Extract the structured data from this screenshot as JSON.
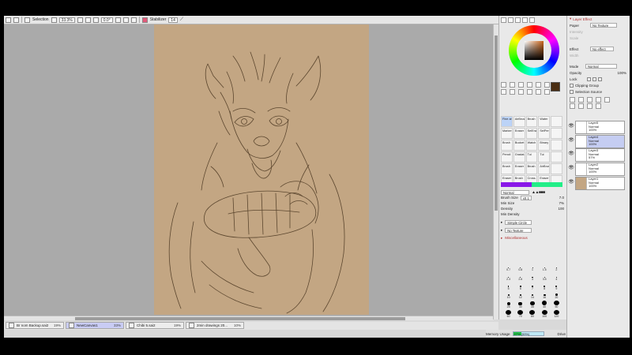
{
  "toolbar": {
    "selection_label": "Selection",
    "zoom": "33.3%",
    "angle": "0.0°",
    "stabilizer_label": "Stabilizer",
    "stabilizer_value": "14"
  },
  "tabs": [
    {
      "name": "Br nom Backup.sai2",
      "pct": "19%"
    },
    {
      "name": "NewCanvas1",
      "pct": "33%"
    },
    {
      "name": "Chibi 5.sai2",
      "pct": "19%"
    },
    {
      "name": "2min drawings 20...",
      "pct": "10%"
    }
  ],
  "status": {
    "memory_label": "Memory Usage",
    "memory_value": "27% (59%)",
    "memory_fraction": 0.27,
    "drive_label": "Drive Space",
    "drive_value": "76%",
    "drive_fraction": 0.76
  },
  "colors": {
    "paper": "#c3a683",
    "current_color": "#4a2d12",
    "accent_green": "#22ee88",
    "accent_purple": "#8a18e8"
  },
  "brush_tools": [
    "Fine art",
    "AirBrush",
    "Brush",
    "Water",
    "",
    "Marker",
    "Eraser",
    "SelEra",
    "SelPen",
    "",
    "Brush",
    "Bucket",
    "Watch",
    "Binary",
    "",
    "Pencil",
    "Gradat...",
    "Tui",
    "Tui",
    "",
    "Brush",
    "Eraser",
    "Brush",
    "AirBrush",
    "",
    "Eraser",
    "Brush",
    "Cross...",
    "Eraser",
    ""
  ],
  "brush_settings": {
    "blend_mode": "Normal",
    "size_label": "Brush Size",
    "size_multiplier": "x0.1",
    "size_value": "7.0",
    "min_size_label": "Min Size",
    "min_size_value": "7%",
    "density_label": "Density",
    "density_value": "100",
    "min_density_label": "Min Density",
    "shape_label": "Simple Circle",
    "texture_label": "No Texture",
    "misc_label": "Miscellaneous"
  },
  "brush_sizes": [
    "0.7",
    "0.8",
    "1",
    "1.5",
    "2",
    "2.3",
    "2.6",
    "3",
    "3.5",
    "4",
    "5",
    "6",
    "7",
    "8",
    "9",
    "10",
    "12",
    "14",
    "16",
    "20",
    "25",
    "30",
    "35",
    "40",
    "50",
    "60",
    "70",
    "80",
    "100",
    "120"
  ],
  "layer_effect": {
    "title": "Layer Effect",
    "paper_label": "Paper",
    "paper_value": "No Texture",
    "intensity_label": "Intensity",
    "scale_label": "Scale",
    "effect_label": "Effect",
    "effect_value": "No effect",
    "width_label": "Width",
    "mode_label": "Mode",
    "mode_value": "Normal",
    "opacity_label": "Opacity",
    "opacity_value": "100%",
    "lock_label": "Lock",
    "clipping_label": "Clipping Group",
    "selection_source_label": "Selection Source"
  },
  "layers": [
    {
      "name": "Layer5",
      "mode": "Normal",
      "opacity": "100%"
    },
    {
      "name": "Layer4",
      "mode": "Normal",
      "opacity": "100%"
    },
    {
      "name": "Layer3",
      "mode": "Normal",
      "opacity": "57%"
    },
    {
      "name": "Layer2",
      "mode": "Normal",
      "opacity": "100%"
    },
    {
      "name": "Layer1",
      "mode": "Normal",
      "opacity": "100%"
    }
  ]
}
